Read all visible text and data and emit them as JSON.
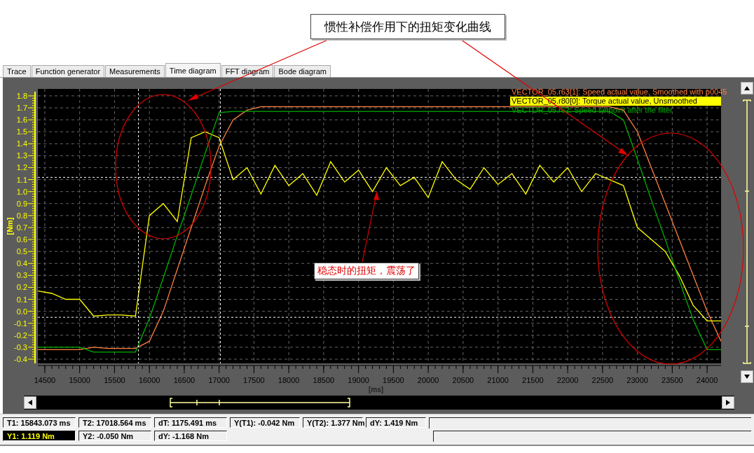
{
  "annotations": {
    "callout": "惯性补偿作用下的扭矩变化曲线",
    "note": "稳态时的扭矩，震荡了"
  },
  "tabs": [
    {
      "label": "Trace",
      "selected": false
    },
    {
      "label": "Function generator",
      "selected": false
    },
    {
      "label": "Measurements",
      "selected": false
    },
    {
      "label": "Time diagram",
      "selected": true
    },
    {
      "label": "FFT diagram",
      "selected": false
    },
    {
      "label": "Bode diagram",
      "selected": false
    }
  ],
  "legend": [
    {
      "selected": false
    },
    {
      "selected": true
    },
    {
      "selected": false
    }
  ],
  "chart_data": {
    "type": "line",
    "xlabel": "[ms]",
    "ylabel": "[Nm]",
    "x": [
      14400,
      14600,
      14800,
      15000,
      15200,
      15400,
      15600,
      15800,
      16000,
      16200,
      16400,
      16600,
      16800,
      17000,
      17200,
      17400,
      17600,
      17800,
      18000,
      18200,
      18400,
      18600,
      18800,
      19000,
      19200,
      19400,
      19600,
      19800,
      20000,
      20200,
      20400,
      20600,
      20800,
      21000,
      21200,
      21400,
      21600,
      21800,
      22000,
      22200,
      22400,
      22600,
      22800,
      23000,
      23200,
      23400,
      23600,
      23800,
      24000,
      24200
    ],
    "series": [
      {
        "name": "VECTOR_05.r63[1]: Speed actual value, Smoothed with p0045",
        "color": "#ff8040",
        "values": [
          -0.32,
          -0.32,
          -0.32,
          -0.32,
          -0.3,
          -0.31,
          -0.31,
          -0.31,
          -0.25,
          0.0,
          0.35,
          0.7,
          1.05,
          1.38,
          1.6,
          1.68,
          1.71,
          1.71,
          1.71,
          1.71,
          1.71,
          1.71,
          1.71,
          1.71,
          1.71,
          1.71,
          1.71,
          1.71,
          1.71,
          1.71,
          1.71,
          1.71,
          1.71,
          1.71,
          1.71,
          1.71,
          1.71,
          1.71,
          1.71,
          1.71,
          1.71,
          1.71,
          1.68,
          1.5,
          1.2,
          0.9,
          0.6,
          0.3,
          0.0,
          -0.25
        ]
      },
      {
        "name": "VECTOR_05.r80[0]: Torque actual value, Unsmoothed",
        "color": "#ffff00",
        "values": [
          0.17,
          0.15,
          0.1,
          0.1,
          -0.04,
          -0.03,
          -0.03,
          -0.04,
          0.8,
          0.9,
          0.75,
          1.45,
          1.5,
          1.45,
          1.1,
          1.2,
          0.98,
          1.22,
          1.05,
          1.15,
          0.97,
          1.25,
          1.08,
          1.18,
          1.0,
          1.2,
          1.05,
          1.12,
          0.95,
          1.25,
          1.1,
          1.02,
          1.2,
          1.06,
          1.15,
          0.98,
          1.22,
          1.08,
          1.2,
          1.0,
          1.15,
          1.1,
          1.05,
          0.7,
          0.6,
          0.5,
          0.3,
          0.05,
          -0.08,
          -0.08
        ]
      },
      {
        "name": "VECTOR_05.r62: Speed setpoint after the filter",
        "color": "#00b000",
        "values": [
          -0.3,
          -0.3,
          -0.3,
          -0.3,
          -0.34,
          -0.34,
          -0.34,
          -0.34,
          -0.06,
          0.28,
          0.63,
          0.97,
          1.32,
          1.66,
          1.67,
          1.67,
          1.67,
          1.67,
          1.67,
          1.67,
          1.67,
          1.67,
          1.67,
          1.67,
          1.67,
          1.67,
          1.67,
          1.67,
          1.67,
          1.67,
          1.67,
          1.67,
          1.67,
          1.67,
          1.67,
          1.67,
          1.67,
          1.67,
          1.67,
          1.67,
          1.67,
          1.67,
          1.6,
          1.27,
          0.93,
          0.6,
          0.26,
          -0.07,
          -0.32,
          -0.32
        ]
      }
    ],
    "xlim": [
      14400,
      24200
    ],
    "ylim": [
      -0.435,
      1.858
    ],
    "grid": true,
    "xticks": [
      14500,
      15000,
      15500,
      16000,
      16500,
      17000,
      17500,
      18000,
      18500,
      19000,
      19500,
      20000,
      20500,
      21000,
      21500,
      22000,
      22500,
      23000,
      23500,
      24000
    ],
    "yticks": [
      -0.4,
      -0.3,
      -0.2,
      -0.1,
      {
        "value": 0,
        "label": "0.0"
      },
      0.1,
      0.2,
      0.3,
      0.4,
      0.5,
      0.6,
      0.7,
      0.8,
      0.9,
      {
        "value": 1,
        "label": "1.0"
      },
      1.1,
      1.2,
      1.3,
      1.4,
      1.5,
      1.6,
      1.7,
      1.8
    ],
    "ref_lines": [
      {
        "axis": "x",
        "value": 15843
      },
      {
        "axis": "x",
        "value": 17018
      },
      {
        "axis": "y",
        "value": 1.119
      },
      {
        "axis": "y",
        "value": -0.05
      }
    ]
  },
  "status": [
    [
      {
        "text": "T1: 15843.073 ms",
        "highlighted": false
      },
      {
        "text": "T2: 17018.564 ms",
        "highlighted": false
      },
      {
        "text": "dT: 1175.491 ms",
        "highlighted": false
      },
      {
        "text": "Y(T1):  -0.042 Nm",
        "highlighted": false
      },
      {
        "text": "Y(T2): 1.377 Nm",
        "highlighted": false
      },
      {
        "text": "dY: 1.419 Nm",
        "highlighted": false
      }
    ],
    [
      {
        "text": "Y1: 1.119 Nm",
        "highlighted": true
      },
      {
        "text": "Y2: -0.050 Nm",
        "highlighted": false
      },
      {
        "text": "dY: -1.168 Nm",
        "highlighted": false
      }
    ]
  ]
}
